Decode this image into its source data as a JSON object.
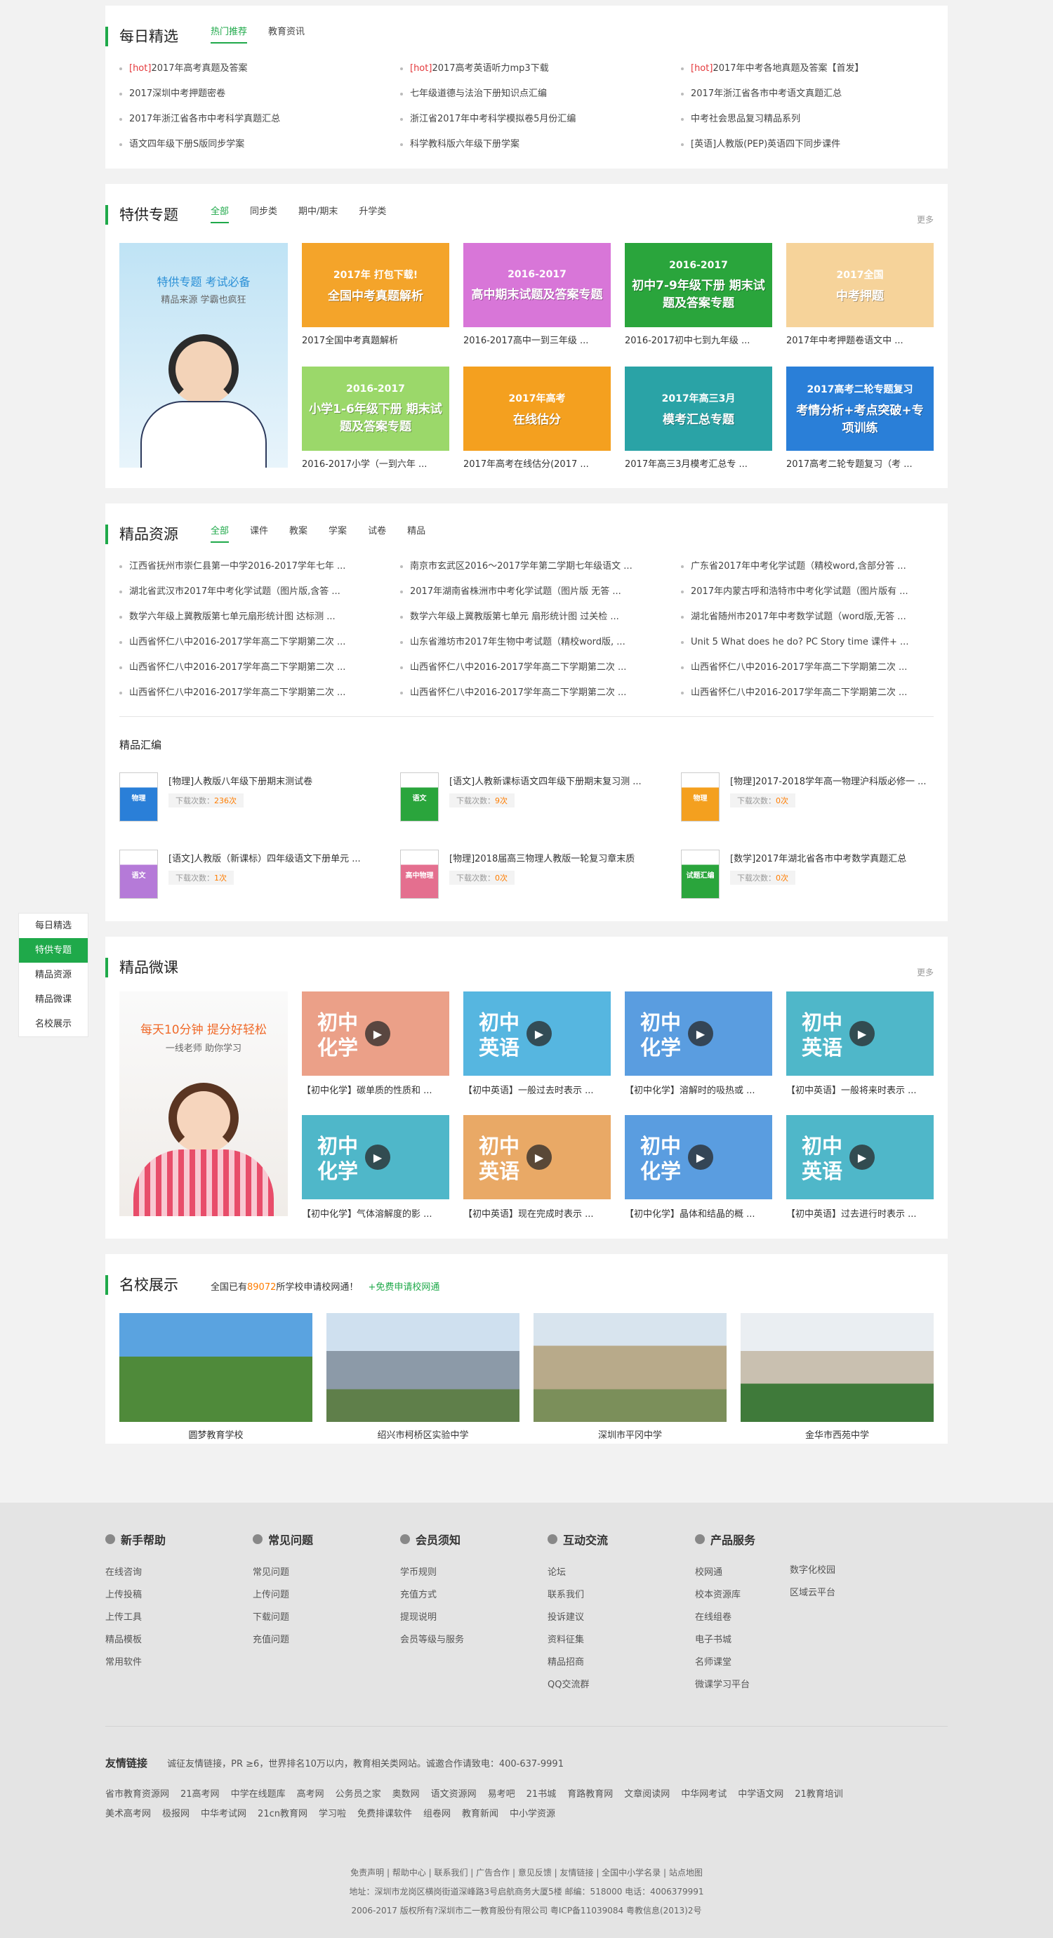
{
  "daily": {
    "title": "每日精选",
    "tabs": [
      "热门推荐",
      "教育资讯"
    ],
    "items": [
      {
        "tag": "[hot]",
        "text": "2017年高考真题及答案"
      },
      {
        "tag": "[hot]",
        "text": "2017高考英语听力mp3下载"
      },
      {
        "tag": "[hot]",
        "text": "2017年中考各地真题及答案【首发】"
      },
      {
        "tag": "",
        "text": "2017深圳中考押题密卷"
      },
      {
        "tag": "",
        "text": "七年级道德与法治下册知识点汇编"
      },
      {
        "tag": "",
        "text": "2017年浙江省各市中考语文真题汇总"
      },
      {
        "tag": "",
        "text": "2017年浙江省各市中考科学真题汇总"
      },
      {
        "tag": "",
        "text": "浙江省2017年中考科学模拟卷5月份汇编"
      },
      {
        "tag": "",
        "text": "中考社会思品复习精品系列"
      },
      {
        "tag": "",
        "text": "语文四年级下册S版同步学案"
      },
      {
        "tag": "",
        "text": "科学教科版六年级下册学案"
      },
      {
        "tag": "",
        "text": "[英语]人教版(PEP)英语四下同步课件"
      }
    ]
  },
  "special": {
    "title": "特供专题",
    "tabs": [
      "全部",
      "同步类",
      "期中/期末",
      "升学类"
    ],
    "more": "更多",
    "feature": {
      "line1": "特供专题  考试必备",
      "line2": "精品来源  学霸也疯狂"
    },
    "cards": [
      {
        "caption": "2017全国中考真题解析",
        "line1": "2017年  打包下载!",
        "line2": "全国中考真题解析",
        "color": "#f4a42a"
      },
      {
        "caption": "2016-2017高中一到三年级 ...",
        "line1": "2016-2017",
        "line2": "高中期末试题及答案专题",
        "color": "#d876d8"
      },
      {
        "caption": "2016-2017初中七到九年级 ...",
        "line1": "2016-2017",
        "line2": "初中7-9年级下册 期末试题及答案专题",
        "color": "#2aa53c"
      },
      {
        "caption": "2017年中考押题卷语文中 ...",
        "line1": "2017全国",
        "line2": "中考押题",
        "color": "#f6d39a"
      },
      {
        "caption": "2016-2017小学（一到六年 ...",
        "line1": "2016-2017",
        "line2": "小学1-6年级下册 期末试题及答案专题",
        "color": "#9bd86a"
      },
      {
        "caption": "2017年高考在线估分(2017 ...",
        "line1": "2017年高考",
        "line2": "在线估分",
        "color": "#f4a01f"
      },
      {
        "caption": "2017年高三3月模考汇总专 ...",
        "line1": "2017年高三3月",
        "line2": "模考汇总专题",
        "color": "#2aa3a6"
      },
      {
        "caption": "2017高考二轮专题复习（考 ...",
        "line1": "2017高考二轮专题复习",
        "line2": "考情分析+考点突破+专项训练",
        "color": "#2a7fd8"
      }
    ]
  },
  "resources": {
    "title": "精品资源",
    "tabs": [
      "全部",
      "课件",
      "教案",
      "学案",
      "试卷",
      "精品"
    ],
    "items": [
      "江西省抚州市崇仁县第一中学2016-2017学年七年 ...",
      "南京市玄武区2016～2017学年第二学期七年级语文 ...",
      "广东省2017年中考化学试题（精校word,含部分答 ...",
      "湖北省武汉市2017年中考化学试题（图片版,含答 ...",
      "2017年湖南省株洲市中考化学试题（图片版 无答 ...",
      "2017年内蒙古呼和浩特市中考化学试题（图片版有 ...",
      "数学六年级上冀教版第七单元扇形统计图 达标测 ...",
      "数学六年级上冀教版第七单元 扇形统计图 过关检 ...",
      "湖北省随州市2017年中考数学试题（word版,无答 ...",
      "山西省怀仁八中2016-2017学年高二下学期第二次 ...",
      "山东省潍坊市2017年生物中考试题（精校word版, ...",
      "Unit 5 What does he do? PC Story time 课件+ ...",
      "山西省怀仁八中2016-2017学年高二下学期第二次 ...",
      "山西省怀仁八中2016-2017学年高二下学期第二次 ...",
      "山西省怀仁八中2016-2017学年高二下学期第二次 ...",
      "山西省怀仁八中2016-2017学年高二下学期第二次 ...",
      "山西省怀仁八中2016-2017学年高二下学期第二次 ...",
      "山西省怀仁八中2016-2017学年高二下学期第二次 ..."
    ],
    "collection_title": "精品汇编",
    "download_label": "下载次数：",
    "books": [
      {
        "title": "[物理]人教版八年级下册期末测试卷",
        "count": "236次",
        "cover": "物理",
        "color": "#2a7fd8"
      },
      {
        "title": "[语文]人教新课标语文四年级下册期末复习测 ...",
        "count": "9次",
        "cover": "语文",
        "color": "#2aa53c"
      },
      {
        "title": "[物理]2017-2018学年高一物理沪科版必修一 ...",
        "count": "0次",
        "cover": "物理",
        "color": "#f4a01f"
      },
      {
        "title": "[语文]人教版（新课标）四年级语文下册单元 ...",
        "count": "1次",
        "cover": "语文",
        "color": "#b57ad8"
      },
      {
        "title": "[物理]2018届高三物理人教版一轮复习章末质",
        "count": "0次",
        "cover": "高中物理",
        "color": "#e46f8f"
      },
      {
        "title": "[数学]2017年湖北省各市中考数学真题汇总",
        "count": "0次",
        "cover": "试题汇编",
        "color": "#2aa53c"
      }
    ]
  },
  "micro": {
    "title": "精品微课",
    "more": "更多",
    "feature": {
      "line1": "每天10分钟  提分好轻松",
      "line2": "一线老师  助你学习"
    },
    "cards": [
      {
        "caption": "【初中化学】碳单质的性质和 ...",
        "label": "初中化学",
        "color": "#eba088"
      },
      {
        "caption": "【初中英语】一般过去时表示 ...",
        "label": "初中英语",
        "color": "#56b6e0"
      },
      {
        "caption": "【初中化学】溶解时的吸热或 ...",
        "label": "初中化学",
        "color": "#5a9de0"
      },
      {
        "caption": "【初中英语】一般将来时表示 ...",
        "label": "初中英语",
        "color": "#4fb7c9"
      },
      {
        "caption": "【初中化学】气体溶解度的影 ...",
        "label": "初中化学",
        "color": "#4fb7c9"
      },
      {
        "caption": "【初中英语】现在完成时表示 ...",
        "label": "初中英语",
        "color": "#e9a966"
      },
      {
        "caption": "【初中化学】晶体和结晶的概 ...",
        "label": "初中化学",
        "color": "#5a9de0"
      },
      {
        "caption": "【初中英语】过去进行时表示 ...",
        "label": "初中英语",
        "color": "#4fb7c9"
      }
    ]
  },
  "schools": {
    "title": "名校展示",
    "desc_pre": "全国已有",
    "count": "89072",
    "desc_post": "所学校申请校网通！",
    "apply": "+免费申请校网通",
    "items": [
      "圆梦教育学校",
      "绍兴市柯桥区实验中学",
      "深圳市平冈中学",
      "金华市西苑中学"
    ]
  },
  "sidebar": [
    "每日精选",
    "特供专题",
    "精品资源",
    "精品微课",
    "名校展示"
  ],
  "footer": {
    "cols": [
      {
        "title": "新手帮助",
        "links": [
          "在线咨询",
          "上传投稿",
          "上传工具",
          "精品模板",
          "常用软件"
        ]
      },
      {
        "title": "常见问题",
        "links": [
          "常见问题",
          "上传问题",
          "下载问题",
          "充值问题"
        ]
      },
      {
        "title": "会员须知",
        "links": [
          "学币规则",
          "充值方式",
          "提现说明",
          "会员等级与服务"
        ]
      },
      {
        "title": "互动交流",
        "links": [
          "论坛",
          "联系我们",
          "投诉建议",
          "资料征集",
          "精品招商",
          "QQ交流群"
        ]
      },
      {
        "title": "产品服务",
        "links": [
          "校网通",
          "校本资源库",
          "在线组卷",
          "电子书城",
          "名师课堂",
          "微课学习平台"
        ]
      }
    ],
    "extra_links": [
      "数字化校园",
      "区域云平台"
    ],
    "friend_title": "友情链接",
    "friend_desc": "诚征友情链接，PR ≥6，世界排名10万以内，教育相关类网站。诚邀合作请致电：400-637-9991",
    "friend_links": [
      "省市教育资源网",
      "21高考网",
      "中学在线题库",
      "高考网",
      "公务员之家",
      "奥数网",
      "语文资源网",
      "易考吧",
      "21书城",
      "育路教育网",
      "文章阅读网",
      "中华网考试",
      "中学语文网",
      "21教育培训",
      "美术高考网",
      "极报网",
      "中华考试网",
      "21cn教育网",
      "学习啦",
      "免费排课软件",
      "组卷网",
      "教育新闻",
      "中小学资源"
    ],
    "bottom_links": "免责声明 | 帮助中心 | 联系我们 | 广告合作 | 意见反馈 | 友情链接 | 全国中小学名录 | 站点地图",
    "address": "地址：深圳市龙岗区横岗街道深峰路3号启航商务大厦5楼 邮编：518000 电话：4006379991",
    "copyright": "2006-2017 版权所有?深圳市二一教育股份有限公司 粤ICP备11039084 粤教信息(2013)2号"
  }
}
